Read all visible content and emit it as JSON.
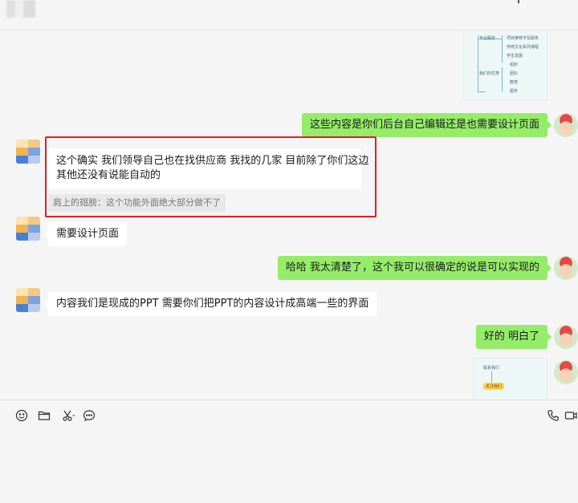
{
  "mindmap_top": {
    "nodes": [
      "专业服务",
      "项目推荐字及服务",
      "传统文化系列课程",
      "学生发展",
      "组织",
      "团队",
      "教育",
      "服务",
      "我们的优势"
    ]
  },
  "messages": [
    {
      "side": "right",
      "text": "这些内容是你们后台自己编辑还是也需要设计页面"
    },
    {
      "side": "left",
      "lines": [
        "这个确实  我们领导自己也在找供应商    我找的几家  目前除了你们这边",
        "其他还没有说能自动的"
      ],
      "quote": "肩上的翅膀：这个功能外面绝大部分做不了"
    },
    {
      "side": "left",
      "text": "需要设计页面"
    },
    {
      "side": "right",
      "text": "哈哈  我太清楚了，这个我可以很确定的说是可以实现的"
    },
    {
      "side": "left",
      "text": "内容我们是现成的PPT   需要你们把PPT的内容设计成高端一些的界面"
    },
    {
      "side": "right",
      "text": "好的  明白了"
    }
  ],
  "mindmap_bottom": {
    "nodes": [
      "联系我们",
      "关注我们"
    ]
  },
  "colors": {
    "sent_bubble": "#95ec69",
    "received_bubble": "#ffffff",
    "highlight_border": "#e02020"
  },
  "toolbar": {
    "left_icons": [
      "emoji-icon",
      "folder-icon",
      "scissors-icon",
      "chat-history-icon"
    ],
    "right_icons": [
      "phone-icon",
      "video-icon"
    ]
  }
}
